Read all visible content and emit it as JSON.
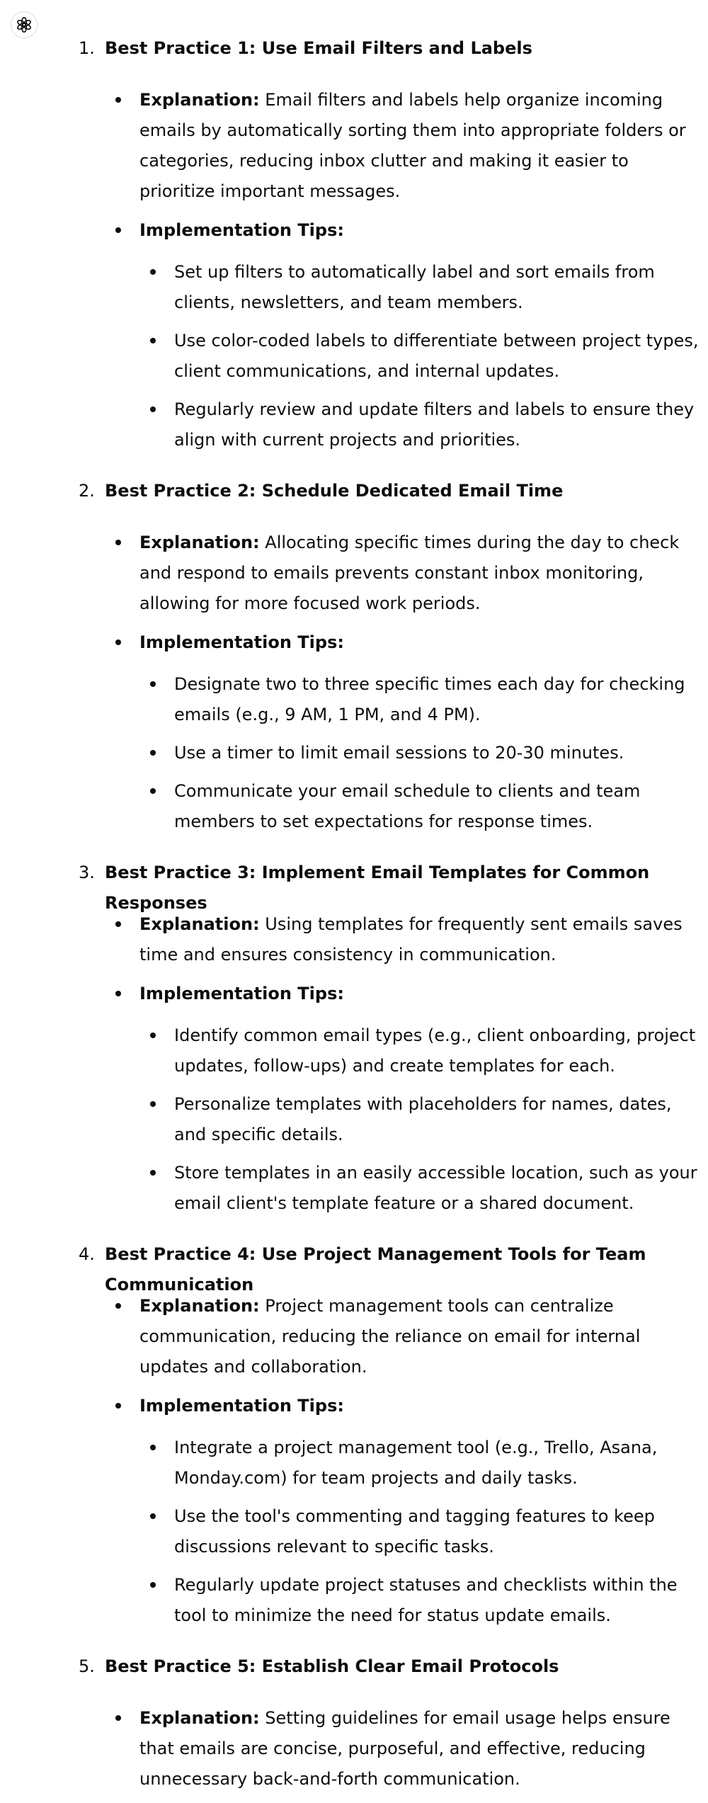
{
  "assistant": {
    "avatar_icon": "openai-logo-icon"
  },
  "practices": [
    {
      "number": "1.",
      "title": "Best Practice 1: Use Email Filters and Labels",
      "explanation_label": "Explanation:",
      "explanation": "Email filters and labels help organize incoming emails by automatically sorting them into appropriate folders or categories, reducing inbox clutter and making it easier to prioritize important messages.",
      "tips_label": "Implementation Tips:",
      "tips": [
        "Set up filters to automatically label and sort emails from clients, newsletters, and team members.",
        "Use color-coded labels to differentiate between project types, client communications, and internal updates.",
        "Regularly review and update filters and labels to ensure they align with current projects and priorities."
      ]
    },
    {
      "number": "2.",
      "title": "Best Practice 2: Schedule Dedicated Email Time",
      "explanation_label": "Explanation:",
      "explanation": "Allocating specific times during the day to check and respond to emails prevents constant inbox monitoring, allowing for more focused work periods.",
      "tips_label": "Implementation Tips:",
      "tips": [
        "Designate two to three specific times each day for checking emails (e.g., 9 AM, 1 PM, and 4 PM).",
        "Use a timer to limit email sessions to 20-30 minutes.",
        "Communicate your email schedule to clients and team members to set expectations for response times."
      ]
    },
    {
      "number": "3.",
      "title": "Best Practice 3: Implement Email Templates for Common Responses",
      "explanation_label": "Explanation:",
      "explanation": "Using templates for frequently sent emails saves time and ensures consistency in communication.",
      "tips_label": "Implementation Tips:",
      "tips": [
        "Identify common email types (e.g., client onboarding, project updates, follow-ups) and create templates for each.",
        "Personalize templates with placeholders for names, dates, and specific details.",
        "Store templates in an easily accessible location, such as your email client's template feature or a shared document."
      ]
    },
    {
      "number": "4.",
      "title": "Best Practice 4: Use Project Management Tools for Team Communication",
      "explanation_label": "Explanation:",
      "explanation": "Project management tools can centralize communication, reducing the reliance on email for internal updates and collaboration.",
      "tips_label": "Implementation Tips:",
      "tips": [
        "Integrate a project management tool (e.g., Trello, Asana, Monday.com) for team projects and daily tasks.",
        "Use the tool's commenting and tagging features to keep discussions relevant to specific tasks.",
        "Regularly update project statuses and checklists within the tool to minimize the need for status update emails."
      ]
    },
    {
      "number": "5.",
      "title": "Best Practice 5: Establish Clear Email Protocols",
      "explanation_label": "Explanation:",
      "explanation": "Setting guidelines for email usage helps ensure that emails are concise, purposeful, and effective, reducing unnecessary back-and-forth communication."
    }
  ]
}
